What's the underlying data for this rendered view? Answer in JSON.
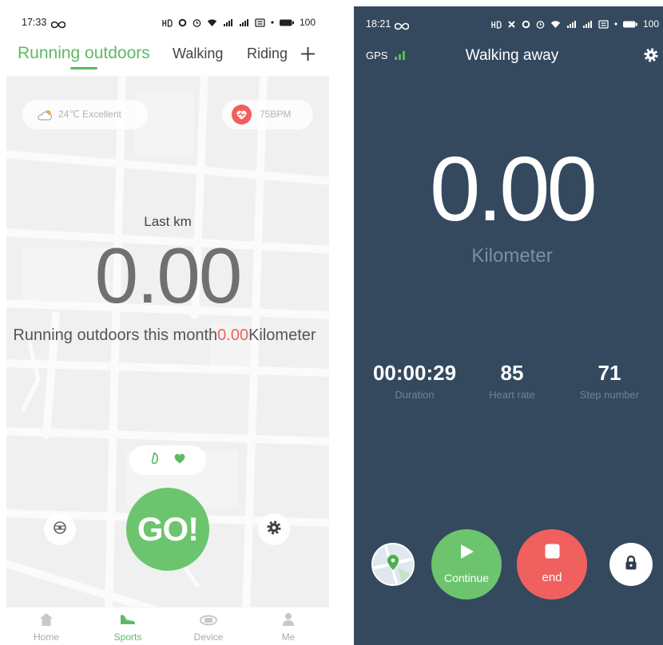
{
  "colors": {
    "accent_green": "#5dba63",
    "button_green": "#6cc46f",
    "alert_red": "#f0605f",
    "dark_panel": "#34495e"
  },
  "left_screen": {
    "status_bar": {
      "time": "17:33",
      "battery_level": "100"
    },
    "tabs": [
      {
        "label": "Running outdoors",
        "active": true
      },
      {
        "label": "Walking",
        "active": false
      },
      {
        "label": "Riding",
        "active": false
      }
    ],
    "add_tab_icon": "plus-icon",
    "weather": {
      "icon": "cloud-sun-icon",
      "text": "24℃ Excellent"
    },
    "heart_rate": {
      "icon": "heart-rate-icon",
      "text": "75BPM"
    },
    "last_km_label": "Last km",
    "distance_value": "0.00",
    "month_summary": {
      "prefix": "Running outdoors this month",
      "value": "0.00",
      "unit": "Kilometer"
    },
    "mode_icons": [
      "shoe-icon",
      "heart-icon"
    ],
    "go_button_label": "GO!",
    "side_buttons": [
      "locate-icon",
      "gear-icon"
    ],
    "nav": [
      {
        "label": "Home",
        "icon": "home-icon",
        "active": false
      },
      {
        "label": "Sports",
        "icon": "sports-icon",
        "active": true
      },
      {
        "label": "Device",
        "icon": "device-icon",
        "active": false
      },
      {
        "label": "Me",
        "icon": "me-icon",
        "active": false
      }
    ]
  },
  "right_screen": {
    "status_bar": {
      "time": "18:21",
      "battery_level": "100"
    },
    "gps_label": "GPS",
    "title": "Walking away",
    "distance_value": "0.00",
    "distance_unit": "Kilometer",
    "stats": [
      {
        "value": "00:00:29",
        "label": "Duration"
      },
      {
        "value": "85",
        "label": "Heart rate"
      },
      {
        "value": "71",
        "label": "Step number"
      }
    ],
    "continue_label": "Continue",
    "end_label": "end",
    "bottom_icons": [
      "map-icon",
      "play-icon",
      "stop-icon",
      "lock-icon"
    ]
  }
}
